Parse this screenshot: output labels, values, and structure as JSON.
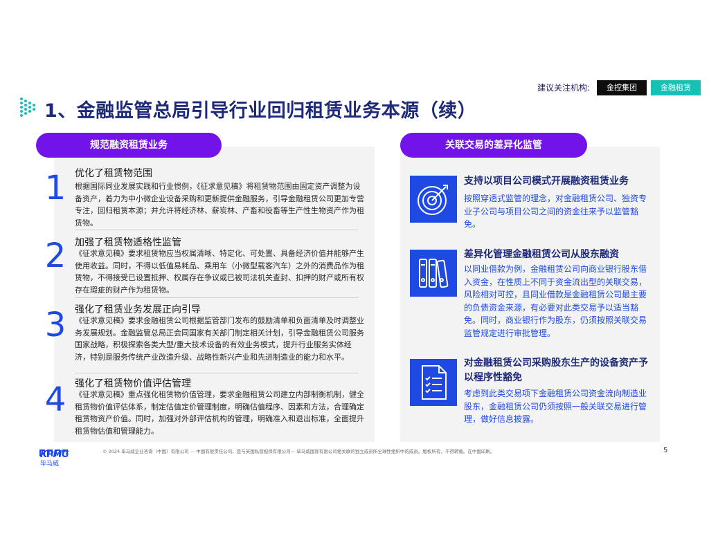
{
  "header": {
    "focus_label": "建议关注机构:",
    "tags": [
      "金控集团",
      "金融租赁"
    ],
    "title": "1、金融监管总局引导行业回归租赁业务本源（续）"
  },
  "left": {
    "pill": "规范融资租赁业务",
    "items": [
      {
        "num": "1",
        "title": "优化了租赁物范围",
        "body": "根据国际同业发展实践和行业惯例，《征求意见稿》将租赁物范围由固定资产调整为设备资产，着力为中小微企业设备采购和更新提供金融服务，引导金融租赁公司更加专营专注，回归租赁本源；并允许将经济林、薪炭林、产畜和役畜等生产性生物资产作为租赁物。"
      },
      {
        "num": "2",
        "title": "加强了租赁物适格性监管",
        "body": "《征求意见稿》要求租赁物应当权属清晰、特定化、可处置、具备经济价值并能够产生使用收益。同时，不得以低值易耗品、乘用车（小微型载客汽车）之外的消费品作为租赁物，不得接受已设置抵押、权属存在争议或已被司法机关查封、扣押的财产或所有权存在瑕疵的财产作为租赁物。"
      },
      {
        "num": "3",
        "title": "强化了租赁业务发展正向引导",
        "body": "《征求意见稿》要求金融租赁公司根据监管部门发布的鼓励清单和负面清单及时调整业务发展规划。金融监管总局正会同国家有关部门制定相关计划，引导金融租赁公司服务国家战略，积极探索各类大型/重大技术设备的有效业务模式，提升行业服务实体经济，特别是服务传统产业改造升级、战略性新兴产业和先进制造业的能力和水平。"
      },
      {
        "num": "4",
        "title": "强化了租赁物价值评估管理",
        "body": "《征求意见稿》重点强化租赁物价值管理，要求金融租赁公司建立内部制衡机制，健全租赁物价值评估体系，制定估值定价管理制度，明确估值程序、因素和方法，合理确定租赁物资产价值。同时，加强对外部评估机构的管理，明确准入和退出标准，全面提升租赁物估值和管理能力。"
      }
    ]
  },
  "right": {
    "pill": "关联交易的差异化监管",
    "items": [
      {
        "icon": "target-icon",
        "title": "支持以项目公司模式开展融资租赁业务",
        "body": "按照穿透式监管的理念，对金融租赁公司、独资专业子公司与项目公司之间的资金往来予以监管豁免。"
      },
      {
        "icon": "binders-icon",
        "title": "差异化管理金融租赁公司从股东融资",
        "body": "以同业借款为例，金融租赁公司向商业银行股东借入资金，在性质上不同于资金流出型的关联交易，风险相对可控，且同业借款是金融租赁公司最主要的负债资金来源，有必要对此类交易予以适当豁免。同时，商业银行作为股东，仍须按照关联交易监管规定进行审批管理。"
      },
      {
        "icon": "checklist-icon",
        "title": "对金融租赁公司采购股东生产的设备资产予以程序性豁免",
        "body": "考虑到此类交易项下金融租赁公司资金流向制造业股东，金融租赁公司仍须按照一般关联交易进行管理，做好信息披露。"
      }
    ]
  },
  "footer": {
    "logo": "KPMG",
    "logo_sub": "毕马威",
    "text": "© 2024 毕马威企业咨询（中国）有限公司 — 中国有限责任公司，是与英国私营担保有限公司— 毕马威国际有限公司相关联的独立成员所全球性组织中的成员。版权所有，不得转载。在中国印刷。",
    "page": "5"
  },
  "colors": {
    "title": "#1e2a78",
    "accent_blue": "#1e49e2",
    "purple": "#7213ea",
    "teal": "#14c2b5",
    "panel_bg": "#f3f3f3"
  }
}
